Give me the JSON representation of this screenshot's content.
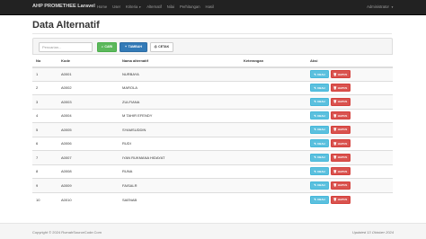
{
  "navbar": {
    "brand": "AHP PROMETHEE Laravel",
    "items": [
      {
        "label": "Home"
      },
      {
        "label": "User"
      },
      {
        "label": "Kriteria"
      },
      {
        "label": "Alternatif"
      },
      {
        "label": "Nilai"
      },
      {
        "label": "Perhitungan"
      },
      {
        "label": "Hasil"
      }
    ],
    "user": "Administrator"
  },
  "page": {
    "title": "Data Alternatif"
  },
  "toolbar": {
    "search_placeholder": "Pencarian...",
    "search_value": "",
    "cari_label": "CARI",
    "tambah_label": "TAMBAH",
    "cetak_label": "CETAK"
  },
  "table": {
    "headers": [
      "No",
      "Kode",
      "Nama alternatif",
      "Keterangan",
      "Aksi"
    ],
    "action_labels": {
      "ubah": "UBAH",
      "hapus": "HAPUS"
    },
    "rows": [
      {
        "no": "1",
        "kode": "A0001",
        "nama": "NURBAYA",
        "keterangan": ""
      },
      {
        "no": "2",
        "kode": "A0002",
        "nama": "MAROLA",
        "keterangan": ""
      },
      {
        "no": "3",
        "kode": "A0003",
        "nama": "ZULFIANA",
        "keterangan": ""
      },
      {
        "no": "4",
        "kode": "A0004",
        "nama": "M TAHIR EFENDY",
        "keterangan": ""
      },
      {
        "no": "5",
        "kode": "A0005",
        "nama": "SYAMSUDDIN",
        "keterangan": ""
      },
      {
        "no": "6",
        "kode": "A0006",
        "nama": "RUDI",
        "keterangan": ""
      },
      {
        "no": "7",
        "kode": "A0007",
        "nama": "IYAN RUKMANA HIDAYAT",
        "keterangan": ""
      },
      {
        "no": "8",
        "kode": "A0008",
        "nama": "RUNA",
        "keterangan": ""
      },
      {
        "no": "9",
        "kode": "A0009",
        "nama": "FAISALR",
        "keterangan": ""
      },
      {
        "no": "10",
        "kode": "A0010",
        "nama": "SAENAB",
        "keterangan": ""
      }
    ]
  },
  "footer": {
    "copyright": "Copyright © 2024 RumahSourceCode.Com",
    "updated": "Updated 13 Oktober 2024"
  },
  "colors": {
    "navbar": "#222222",
    "success": "#5cb85c",
    "primary": "#337ab7",
    "info": "#5bc0de",
    "danger": "#d9534f"
  },
  "icons": {
    "search": "search-icon",
    "plus": "plus-icon",
    "print": "print-icon",
    "edit": "edit-icon",
    "delete": "trash-icon"
  }
}
